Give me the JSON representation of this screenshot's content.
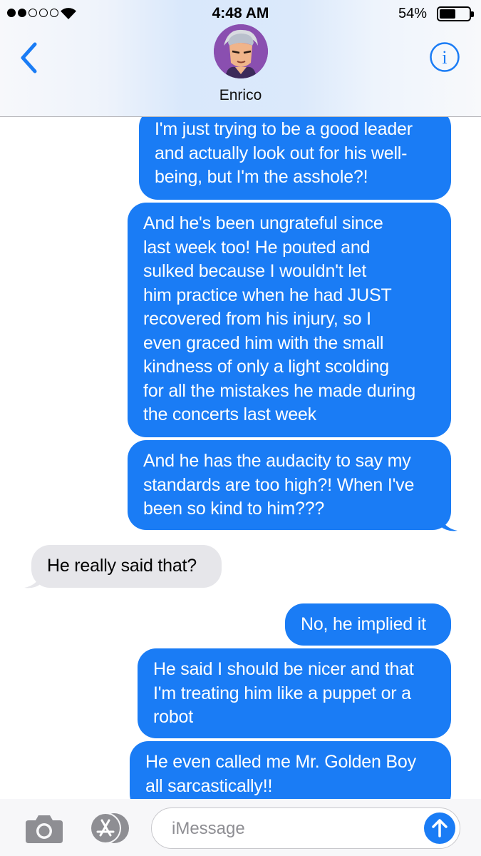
{
  "status_bar": {
    "time": "4:48 AM",
    "battery_percent": "54%",
    "battery_level": 0.54,
    "signal_bars_filled": 2,
    "signal_bars_total": 5
  },
  "header": {
    "contact_name": "Enrico",
    "back_icon": "chevron-left-icon",
    "info_icon": "info-icon"
  },
  "messages": [
    {
      "direction": "outgoing",
      "text": "I'm just trying to be a good leader\nand actually look out for his well-\nbeing, but I'm the asshole?!"
    },
    {
      "direction": "outgoing",
      "text": "And he's been ungrateful since\nlast week too! He pouted and\nsulked because I wouldn't let\nhim practice when he had JUST\nrecovered from his injury, so I\neven graced him with the small\nkindness of only a light scolding\nfor all the mistakes he made during\nthe concerts last week"
    },
    {
      "direction": "outgoing",
      "text": "And he has the audacity to say my\nstandards are too high?! When I've\nbeen so kind to him???"
    },
    {
      "direction": "incoming",
      "text": "He really said that?"
    },
    {
      "direction": "outgoing",
      "text": "No, he implied it"
    },
    {
      "direction": "outgoing",
      "text": "He said I should be nicer and that\nI'm treating him like a puppet or a\nrobot"
    },
    {
      "direction": "outgoing",
      "text": "He even called me Mr. Golden Boy\nall sarcastically!!"
    }
  ],
  "input_bar": {
    "placeholder": "iMessage",
    "camera_icon": "camera-icon",
    "appstore_icon": "app-store-icon",
    "send_icon": "send-arrow-icon"
  },
  "colors": {
    "outgoing_bubble": "#1a7cf5",
    "incoming_bubble": "#e6e6ea",
    "accent": "#1a7cf5"
  }
}
